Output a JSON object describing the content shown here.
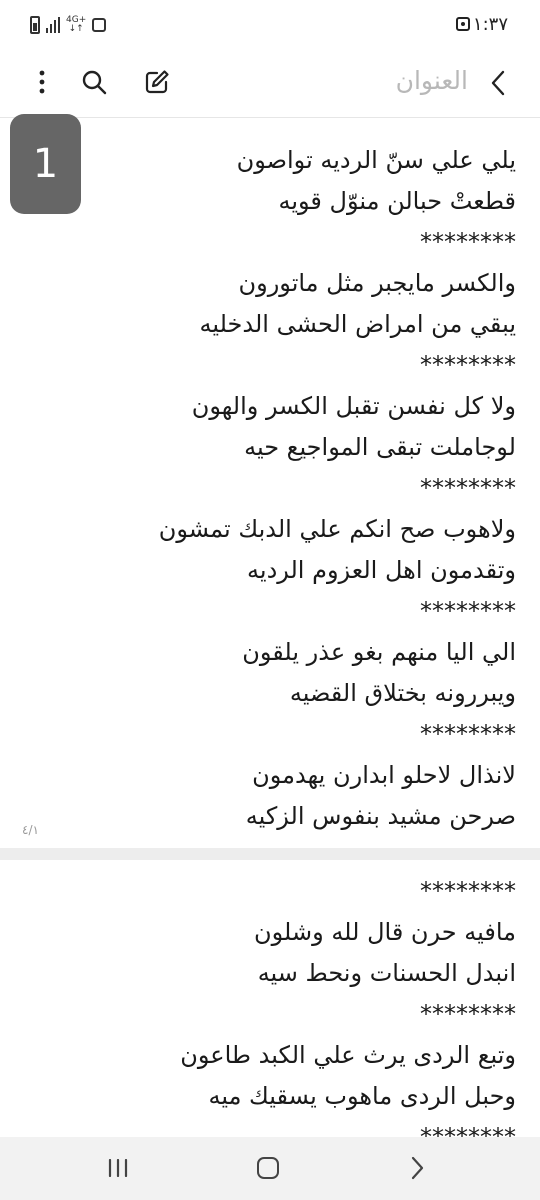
{
  "status_bar": {
    "time": "١:٣٧",
    "network": "4G+"
  },
  "app_bar": {
    "title_placeholder": "العنوان"
  },
  "page_badge": "1",
  "page_indicator": "٤/١",
  "content_page_1": [
    "يلي علي سنّ الرديه تواصون",
    "قطعتْ حبالن منوّل قويه",
    "********",
    "والكسر مايجبر مثل ماتورون",
    "يبقي من امراض الحشى الدخليه",
    "********",
    "ولا كل نفسن تقبل الكسر والهون",
    "لوجاملت تبقى المواجيع حيه",
    "********",
    "ولاهوب صح انكم علي الدبك تمشون",
    "وتقدمون اهل العزوم الرديه",
    "********",
    "الي اليا منهم بغو عذر يلقون",
    "ويبررونه بختلاق القضيه",
    "********",
    "لانذال لاحلو ابدارن يهدمون",
    "صرحن مشيد بنفوس الزكيه"
  ],
  "content_page_2": [
    "********",
    "مافيه حرن قال لله وشلون",
    "انبدل الحسنات ونحط سيه",
    "********",
    "وتبع الردى يرث علي الكبد طاعون",
    "وحبل الردى ماهوب يسقيك ميه",
    "********"
  ],
  "icons": {
    "back": "chevron-right-icon",
    "edit": "edit-icon",
    "search": "search-icon",
    "more": "more-vertical-icon",
    "nav_recent": "recent-apps-icon",
    "nav_home": "home-icon",
    "nav_back": "nav-back-icon"
  }
}
